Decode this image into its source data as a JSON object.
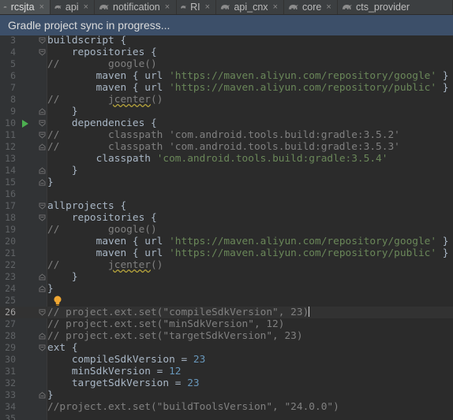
{
  "tabs": [
    {
      "label": "rcsjta",
      "close": "×",
      "active": true
    },
    {
      "label": "api",
      "close": "×",
      "active": false
    },
    {
      "label": "notification",
      "close": "×",
      "active": false
    },
    {
      "label": "RI",
      "close": "×",
      "active": false
    },
    {
      "label": "api_cnx",
      "close": "×",
      "active": false
    },
    {
      "label": "core",
      "close": "×",
      "active": false
    },
    {
      "label": "cts_provider",
      "close": "",
      "active": false
    }
  ],
  "notification": {
    "text": "Gradle project sync in progress..."
  },
  "colors": {
    "background": "#2b2b2b",
    "gutter": "#313335",
    "notification": "#3c4f69",
    "comment": "#808080",
    "string": "#6a8759",
    "number": "#6897bb",
    "text": "#a9b7c6",
    "run": "#4caf50",
    "bulb": "#f0a732"
  },
  "editor": {
    "current_line": 26,
    "lines": [
      {
        "num": "3",
        "fold": "open",
        "tokens": [
          {
            "t": "buildscript {",
            "c": "plain"
          }
        ]
      },
      {
        "num": "4",
        "fold": "open",
        "tokens": [
          {
            "t": "    repositories {",
            "c": "plain"
          }
        ]
      },
      {
        "num": "5",
        "fold": "",
        "tokens": [
          {
            "t": "//        google()",
            "c": "comment"
          }
        ]
      },
      {
        "num": "6",
        "fold": "",
        "tokens": [
          {
            "t": "        maven { url ",
            "c": "plain"
          },
          {
            "t": "'https://maven.aliyun.com/repository/google'",
            "c": "string"
          },
          {
            "t": " }",
            "c": "plain"
          }
        ]
      },
      {
        "num": "7",
        "fold": "",
        "tokens": [
          {
            "t": "        maven { url ",
            "c": "plain"
          },
          {
            "t": "'https://maven.aliyun.com/repository/public'",
            "c": "string"
          },
          {
            "t": " }",
            "c": "plain"
          }
        ]
      },
      {
        "num": "8",
        "fold": "",
        "tokens": [
          {
            "t": "//        ",
            "c": "comment"
          },
          {
            "t": "jcenter",
            "c": "link"
          },
          {
            "t": "()",
            "c": "comment"
          }
        ]
      },
      {
        "num": "9",
        "fold": "close",
        "tokens": [
          {
            "t": "    }",
            "c": "plain"
          }
        ]
      },
      {
        "num": "10",
        "fold": "open",
        "run": true,
        "tokens": [
          {
            "t": "    dependencies {",
            "c": "plain"
          }
        ]
      },
      {
        "num": "11",
        "fold": "open",
        "tokens": [
          {
            "t": "//        classpath 'com.android.tools.build:gradle:3.5.2'",
            "c": "comment"
          }
        ]
      },
      {
        "num": "12",
        "fold": "close",
        "tokens": [
          {
            "t": "//        classpath 'com.android.tools.build:gradle:3.5.3'",
            "c": "comment"
          }
        ]
      },
      {
        "num": "13",
        "fold": "",
        "tokens": [
          {
            "t": "        classpath ",
            "c": "plain"
          },
          {
            "t": "'com.android.tools.build:gradle:3.5.4'",
            "c": "string"
          }
        ]
      },
      {
        "num": "14",
        "fold": "close",
        "tokens": [
          {
            "t": "    }",
            "c": "plain"
          }
        ]
      },
      {
        "num": "15",
        "fold": "close",
        "tokens": [
          {
            "t": "}",
            "c": "plain"
          }
        ]
      },
      {
        "num": "16",
        "fold": "",
        "tokens": []
      },
      {
        "num": "17",
        "fold": "open",
        "tokens": [
          {
            "t": "allprojects {",
            "c": "plain"
          }
        ]
      },
      {
        "num": "18",
        "fold": "open",
        "tokens": [
          {
            "t": "    repositories {",
            "c": "plain"
          }
        ]
      },
      {
        "num": "19",
        "fold": "",
        "tokens": [
          {
            "t": "//        google()",
            "c": "comment"
          }
        ]
      },
      {
        "num": "20",
        "fold": "",
        "tokens": [
          {
            "t": "        maven { url ",
            "c": "plain"
          },
          {
            "t": "'https://maven.aliyun.com/repository/google'",
            "c": "string"
          },
          {
            "t": " }",
            "c": "plain"
          }
        ]
      },
      {
        "num": "21",
        "fold": "",
        "tokens": [
          {
            "t": "        maven { url ",
            "c": "plain"
          },
          {
            "t": "'https://maven.aliyun.com/repository/public'",
            "c": "string"
          },
          {
            "t": " }",
            "c": "plain"
          }
        ]
      },
      {
        "num": "22",
        "fold": "",
        "tokens": [
          {
            "t": "//        ",
            "c": "comment"
          },
          {
            "t": "jcenter",
            "c": "link"
          },
          {
            "t": "()",
            "c": "comment"
          }
        ]
      },
      {
        "num": "23",
        "fold": "close",
        "tokens": [
          {
            "t": "    }",
            "c": "plain"
          }
        ]
      },
      {
        "num": "24",
        "fold": "close",
        "tokens": [
          {
            "t": "}",
            "c": "plain"
          }
        ]
      },
      {
        "num": "25",
        "fold": "",
        "bulb": true,
        "tokens": []
      },
      {
        "num": "26",
        "fold": "open",
        "current": true,
        "tokens": [
          {
            "t": "// project.ext.set(\"compileSdkVersion\", 23)",
            "c": "comment"
          }
        ]
      },
      {
        "num": "27",
        "fold": "",
        "tokens": [
          {
            "t": "// project.ext.set(\"minSdkVersion\", 12)",
            "c": "comment"
          }
        ]
      },
      {
        "num": "28",
        "fold": "close",
        "tokens": [
          {
            "t": "// project.ext.set(\"targetSdkVersion\", 23)",
            "c": "comment"
          }
        ]
      },
      {
        "num": "29",
        "fold": "open",
        "tokens": [
          {
            "t": "ext {",
            "c": "plain"
          }
        ]
      },
      {
        "num": "30",
        "fold": "",
        "tokens": [
          {
            "t": "    compileSdkVersion = ",
            "c": "plain"
          },
          {
            "t": "23",
            "c": "number"
          }
        ]
      },
      {
        "num": "31",
        "fold": "",
        "tokens": [
          {
            "t": "    minSdkVersion = ",
            "c": "plain"
          },
          {
            "t": "12",
            "c": "number"
          }
        ]
      },
      {
        "num": "32",
        "fold": "",
        "tokens": [
          {
            "t": "    targetSdkVersion = ",
            "c": "plain"
          },
          {
            "t": "23",
            "c": "number"
          }
        ]
      },
      {
        "num": "33",
        "fold": "close",
        "tokens": [
          {
            "t": "}",
            "c": "plain"
          }
        ]
      },
      {
        "num": "34",
        "fold": "",
        "tokens": [
          {
            "t": "//project.ext.set(\"buildToolsVersion\", \"24.0.0\")",
            "c": "comment"
          }
        ]
      },
      {
        "num": "35",
        "fold": "",
        "tokens": []
      }
    ]
  }
}
